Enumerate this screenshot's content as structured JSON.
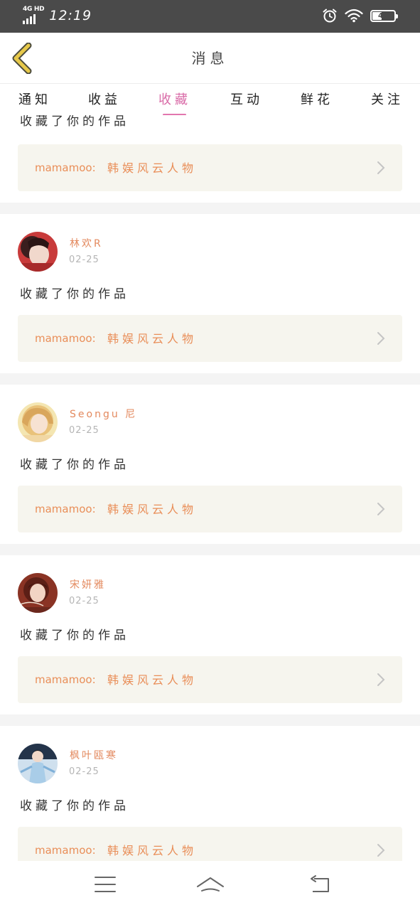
{
  "status_bar": {
    "network": "4G HD",
    "time": "12:19",
    "battery_text": "43",
    "battery_level": 0.43,
    "icons": [
      "signal-icon",
      "alarm-icon",
      "wifi-icon",
      "battery-icon"
    ]
  },
  "header": {
    "title": "消息",
    "back_icon": "chevron-left-icon"
  },
  "tabs": [
    {
      "label": "通知",
      "active": false
    },
    {
      "label": "收益",
      "active": false
    },
    {
      "label": "收藏",
      "active": true
    },
    {
      "label": "互动",
      "active": false
    },
    {
      "label": "鲜花",
      "active": false
    },
    {
      "label": "关注",
      "active": false
    }
  ],
  "feed": {
    "partial_item": {
      "action": "收藏了你的作品",
      "work_author": "mamamoo:",
      "work_title": "韩娱风云人物"
    },
    "items": [
      {
        "user": "林欢R",
        "date": "02-25",
        "action": "收藏了你的作品",
        "work_author": "mamamoo:",
        "work_title": "韩娱风云人物"
      },
      {
        "user": "Seongu 尼",
        "date": "02-25",
        "action": "收藏了你的作品",
        "work_author": "mamamoo:",
        "work_title": "韩娱风云人物"
      },
      {
        "user": "宋妍雅",
        "date": "02-25",
        "action": "收藏了你的作品",
        "work_author": "mamamoo:",
        "work_title": "韩娱风云人物"
      },
      {
        "user": "枫叶瓯寒",
        "date": "02-25",
        "action": "收藏了你的作品",
        "work_author": "mamamoo:",
        "work_title": "韩娱风云人物"
      }
    ]
  },
  "navbar": {
    "buttons": [
      "menu-icon",
      "home-icon",
      "back-arrow-icon"
    ]
  },
  "colors": {
    "accent": "#e276ae",
    "username": "#e3895e",
    "card_bg": "#f6f5ee",
    "back_icon": "#e6c84a"
  }
}
